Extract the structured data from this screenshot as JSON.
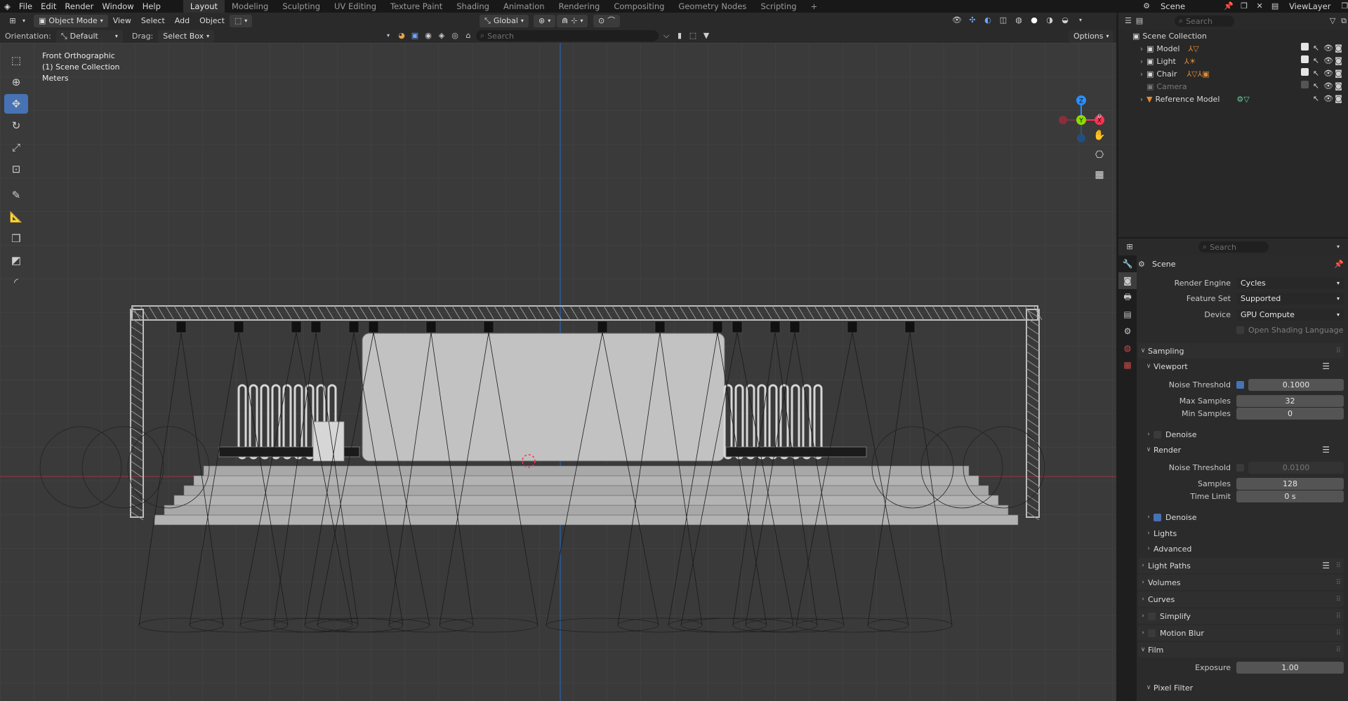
{
  "menu": {
    "items": [
      "File",
      "Edit",
      "Render",
      "Window",
      "Help"
    ]
  },
  "workspaces": [
    "Layout",
    "Modeling",
    "Sculpting",
    "UV Editing",
    "Texture Paint",
    "Shading",
    "Animation",
    "Rendering",
    "Compositing",
    "Geometry Nodes",
    "Scripting"
  ],
  "active_workspace": "Layout",
  "scene_name": "Scene",
  "view_layer": "ViewLayer",
  "viewport_header": {
    "mode": "Object Mode",
    "menus": [
      "View",
      "Select",
      "Add",
      "Object"
    ],
    "transform": "Global",
    "orientation_label": "Orientation:",
    "orientation_value": "Default",
    "drag_label": "Drag:",
    "drag_value": "Select Box",
    "options": "Options",
    "search_placeholder": "Search"
  },
  "viewport_info": {
    "view": "Front Orthographic",
    "collection": "(1) Scene Collection",
    "units": "Meters"
  },
  "gizmo": {
    "z": "Z",
    "y": "Y",
    "x": "X"
  },
  "outliner": {
    "search_placeholder": "Search",
    "root": "Scene Collection",
    "items": [
      {
        "name": "Model",
        "enabled": true
      },
      {
        "name": "Light",
        "enabled": true
      },
      {
        "name": "Chair",
        "enabled": true
      },
      {
        "name": "Camera",
        "enabled": false
      },
      {
        "name": "Reference Model",
        "enabled": true
      }
    ]
  },
  "properties": {
    "search_placeholder": "Search",
    "context": "Scene",
    "render_engine_label": "Render Engine",
    "render_engine": "Cycles",
    "feature_set_label": "Feature Set",
    "feature_set": "Supported",
    "device_label": "Device",
    "device": "GPU Compute",
    "osl_label": "Open Shading Language",
    "sampling": "Sampling",
    "viewport": "Viewport",
    "noise_threshold_label": "Noise Threshold",
    "vp_noise_threshold": "0.1000",
    "max_samples_label": "Max Samples",
    "max_samples": "32",
    "min_samples_label": "Min Samples",
    "min_samples": "0",
    "denoise": "Denoise",
    "render": "Render",
    "render_noise_threshold": "0.0100",
    "samples_label": "Samples",
    "samples": "128",
    "time_limit_label": "Time Limit",
    "time_limit": "0 s",
    "lights": "Lights",
    "advanced": "Advanced",
    "light_paths": "Light Paths",
    "volumes": "Volumes",
    "curves": "Curves",
    "simplify": "Simplify",
    "motion_blur": "Motion Blur",
    "film": "Film",
    "exposure_label": "Exposure",
    "exposure": "1.00",
    "pixel_filter": "Pixel Filter"
  },
  "colors": {
    "accent": "#4772b3",
    "axis_x": "#ff3352",
    "axis_y": "#8bdc00",
    "axis_z": "#2890ff"
  }
}
